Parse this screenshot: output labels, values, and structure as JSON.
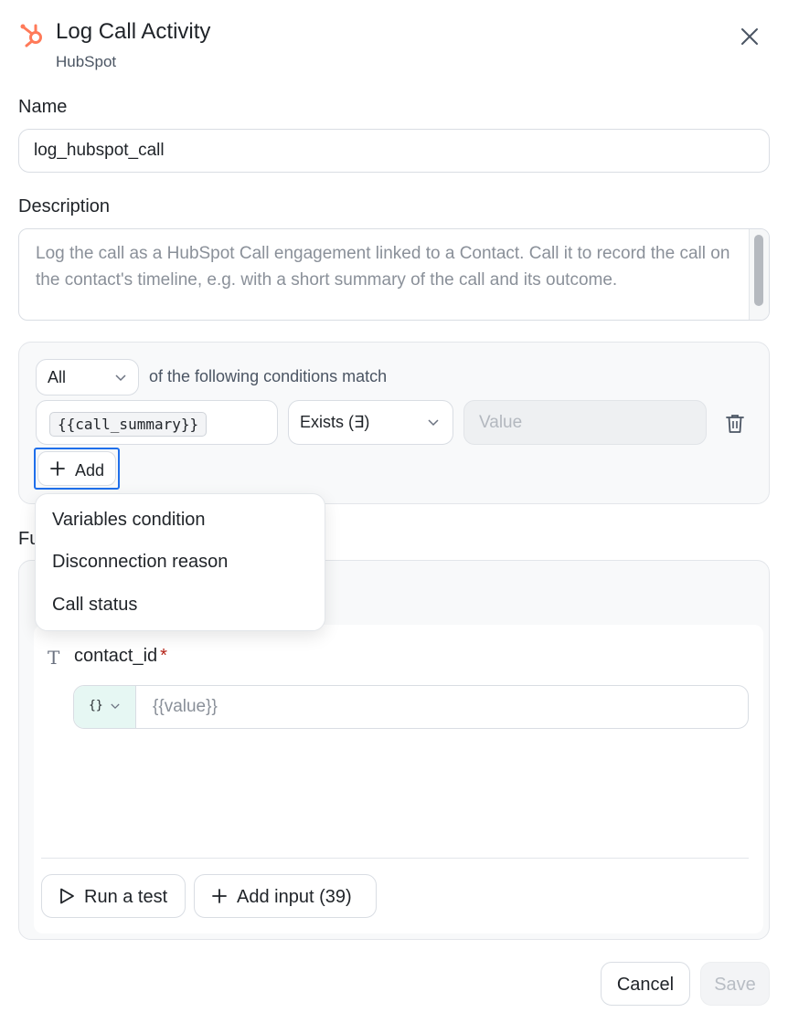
{
  "header": {
    "title": "Log Call Activity",
    "subtitle": "HubSpot",
    "brand_color": "#ff7a59"
  },
  "name": {
    "label": "Name",
    "value": "log_hubspot_call"
  },
  "description": {
    "label": "Description",
    "value": "Log the call as a HubSpot Call engagement linked to a Contact. Call it to record the call on the contact's timeline, e.g. with a short summary of the call and its outcome."
  },
  "conditions": {
    "match_select": "All",
    "match_text": "of the following conditions match",
    "rows": [
      {
        "variable": "{{call_summary}}",
        "operator": "Exists (∃)",
        "value_placeholder": "Value"
      }
    ],
    "add_label": "Add"
  },
  "dropdown": {
    "items": [
      "Variables condition",
      "Disconnection reason",
      "Call status"
    ]
  },
  "function": {
    "label_partial": "Fu",
    "field": {
      "name": "contact_id",
      "required_mark": "*",
      "type_label": "{}",
      "value_placeholder": "{{value}}"
    },
    "run_test_label": "Run a test",
    "add_input_label": "Add input (39)"
  },
  "footer": {
    "cancel_label": "Cancel",
    "save_label": "Save"
  }
}
